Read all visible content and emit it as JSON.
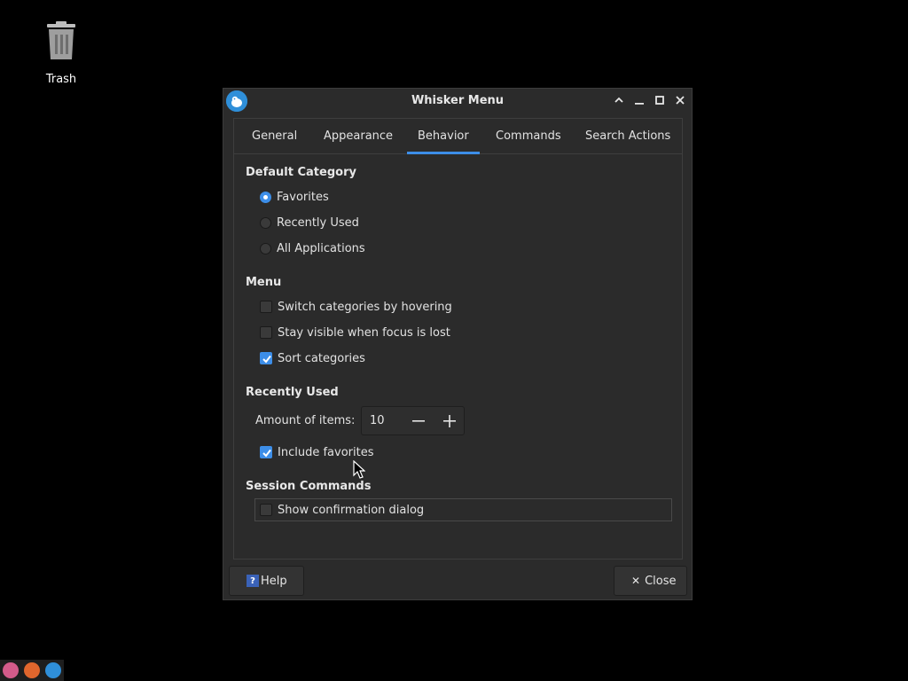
{
  "desktop": {
    "trash_label": "Trash"
  },
  "window": {
    "title": "Whisker Menu",
    "tabs": [
      {
        "label": "General"
      },
      {
        "label": "Appearance"
      },
      {
        "label": "Behavior",
        "active": true
      },
      {
        "label": "Commands"
      },
      {
        "label": "Search Actions"
      }
    ],
    "default_category": {
      "title": "Default Category",
      "options": [
        {
          "label": "Favorites",
          "selected": true
        },
        {
          "label": "Recently Used",
          "selected": false
        },
        {
          "label": "All Applications",
          "selected": false
        }
      ]
    },
    "menu": {
      "title": "Menu",
      "options": [
        {
          "label": "Switch categories by hovering",
          "checked": false
        },
        {
          "label": "Stay visible when focus is lost",
          "checked": false
        },
        {
          "label": "Sort categories",
          "checked": true
        }
      ]
    },
    "recently_used": {
      "title": "Recently Used",
      "amount_label": "Amount of items:",
      "amount_value": "10",
      "include_favorites_label": "Include favorites",
      "include_favorites_checked": true
    },
    "session_commands": {
      "title": "Session Commands",
      "confirm_label": "Show confirmation dialog",
      "confirm_checked": false
    },
    "help_label": "Help",
    "close_label": "Close"
  },
  "colors": {
    "accent": "#3d8ee8",
    "window_bg": "#2b2b2b",
    "desktop_bg": "#000000"
  }
}
